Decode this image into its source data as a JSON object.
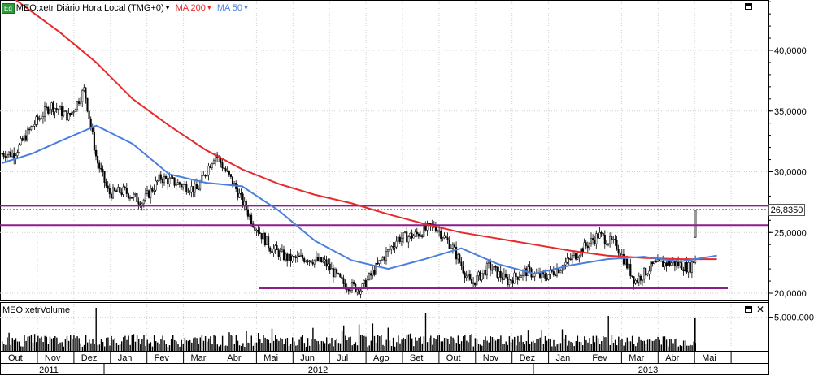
{
  "header": {
    "badge": "Eq",
    "symbol_label": "MEO:xetr Diário Hora Local (TMG+0)",
    "ma200_label": "MA 200",
    "ma50_label": "MA 50",
    "caret": "▼"
  },
  "volume_panel": {
    "title": "MEO:xetrVolume",
    "close_glyph": "✕"
  },
  "last_price": "26,8350",
  "colors": {
    "ma200": "#e8282a",
    "ma50": "#4a7fe0",
    "support_lines": "#8a1e8a",
    "candle": "#000000",
    "badge": "#2e9a3a"
  },
  "chart_data": [
    {
      "type": "line",
      "chart_kind": "candlestick with moving averages",
      "title": "MEO:xetr Diário Hora Local (TMG+0)",
      "y_axis_side": "right",
      "ylim": [
        19500,
        45000
      ],
      "y_ticks": [
        {
          "value": 20000,
          "label": "20,0000"
        },
        {
          "value": 25000,
          "label": "25,0000"
        },
        {
          "value": 30000,
          "label": "30,0000"
        },
        {
          "value": 35000,
          "label": "35,0000"
        },
        {
          "value": 40000,
          "label": "40,0000"
        }
      ],
      "x_months": [
        "Out",
        "Nov",
        "Dez",
        "Jan",
        "Fev",
        "Mar",
        "Abr",
        "Mai",
        "Jun",
        "Jul",
        "Ago",
        "Set",
        "Out",
        "Nov",
        "Dez",
        "Jan",
        "Fev",
        "Mar",
        "Abr",
        "Mai"
      ],
      "x_years": [
        "2011",
        "2012",
        "2013"
      ],
      "series": [
        {
          "name": "MEO:xetr",
          "kind": "candlestick",
          "close_path": [
            [
              "Out 2011",
              31500
            ],
            [
              "Out 2011",
              33800
            ],
            [
              "Nov 2011",
              35500
            ],
            [
              "Nov 2011",
              34500
            ],
            [
              "Dez 2011",
              36800
            ],
            [
              "Dez 2011",
              31000
            ],
            [
              "Dez 2011",
              28200
            ],
            [
              "Jan 2012",
              28400
            ],
            [
              "Jan 2012",
              27500
            ],
            [
              "Fev 2012",
              29500
            ],
            [
              "Fev 2012",
              29000
            ],
            [
              "Mar 2012",
              28500
            ],
            [
              "Mar 2012",
              31500
            ],
            [
              "Abr 2012",
              29000
            ],
            [
              "Abr 2012",
              26000
            ],
            [
              "Mai 2012",
              23800
            ],
            [
              "Mai 2012",
              22800
            ],
            [
              "Jun 2012",
              22900
            ],
            [
              "Jun 2012",
              22500
            ],
            [
              "Jul 2012",
              20800
            ],
            [
              "Jul 2012",
              20300
            ],
            [
              "Ago 2012",
              22500
            ],
            [
              "Ago 2012",
              24500
            ],
            [
              "Set 2012",
              24800
            ],
            [
              "Set 2012",
              25600
            ],
            [
              "Out 2012",
              23800
            ],
            [
              "Out 2012",
              20700
            ],
            [
              "Nov 2012",
              22200
            ],
            [
              "Nov 2012",
              21000
            ],
            [
              "Dez 2012",
              21800
            ],
            [
              "Dez 2012",
              21300
            ],
            [
              "Jan 2013",
              22200
            ],
            [
              "Jan 2013",
              23500
            ],
            [
              "Fev 2013",
              24800
            ],
            [
              "Fev 2013",
              23900
            ],
            [
              "Mar 2013",
              21000
            ],
            [
              "Mar 2013",
              22300
            ],
            [
              "Abr 2013",
              22500
            ],
            [
              "Abr 2013",
              22100
            ],
            [
              "Mai 2013",
              24500
            ],
            [
              "Mai 2013",
              24600
            ],
            [
              "Mai 2013",
              26835
            ]
          ],
          "last": 26835
        },
        {
          "name": "MA 200",
          "path": [
            [
              "Out 2011",
              45000
            ],
            [
              "Nov 2011",
              41500
            ],
            [
              "Dez 2011",
              39000
            ],
            [
              "Jan 2012",
              36000
            ],
            [
              "Fev 2012",
              33800
            ],
            [
              "Mar 2012",
              31800
            ],
            [
              "Abr 2012",
              30200
            ],
            [
              "Mai 2012",
              29000
            ],
            [
              "Jun 2012",
              28100
            ],
            [
              "Jul 2012",
              27400
            ],
            [
              "Ago 2012",
              26500
            ],
            [
              "Set 2012",
              25700
            ],
            [
              "Out 2012",
              25000
            ],
            [
              "Nov 2012",
              24500
            ],
            [
              "Dez 2012",
              24000
            ],
            [
              "Jan 2013",
              23500
            ],
            [
              "Fev 2013",
              23100
            ],
            [
              "Mar 2013",
              22900
            ],
            [
              "Abr 2013",
              22800
            ],
            [
              "Mai 2013",
              22800
            ]
          ]
        },
        {
          "name": "MA 50",
          "path": [
            [
              "Out 2011",
              30700
            ],
            [
              "Out 2011",
              31500
            ],
            [
              "Nov 2011",
              32500
            ],
            [
              "Dez 2011",
              33800
            ],
            [
              "Jan 2012",
              32300
            ],
            [
              "Fev 2012",
              29800
            ],
            [
              "Mar 2012",
              29100
            ],
            [
              "Abr 2012",
              28800
            ],
            [
              "Mai 2012",
              26800
            ],
            [
              "Jun 2012",
              24300
            ],
            [
              "Jul 2012",
              22700
            ],
            [
              "Ago 2012",
              22000
            ],
            [
              "Set 2012",
              22800
            ],
            [
              "Out 2012",
              23700
            ],
            [
              "Nov 2012",
              22400
            ],
            [
              "Dez 2012",
              21600
            ],
            [
              "Jan 2013",
              22300
            ],
            [
              "Fev 2013",
              22800
            ],
            [
              "Mar 2013",
              23000
            ],
            [
              "Abr 2013",
              22600
            ],
            [
              "Mai 2013",
              23100
            ]
          ]
        }
      ],
      "horizontal_lines": [
        {
          "value": 27200,
          "style": "solid"
        },
        {
          "value": 26900,
          "style": "dotted"
        },
        {
          "value": 25600,
          "style": "solid"
        },
        {
          "value": 20400,
          "style": "solid",
          "span": "Jun 2012 – Mai 2013"
        }
      ]
    },
    {
      "type": "bar",
      "title": "MEO:xetrVolume",
      "y_ticks": [
        {
          "value": 5000000,
          "label": "5.000.000"
        }
      ],
      "ylim": [
        0,
        7000000
      ],
      "notable_spikes": [
        [
          "Dez 2011",
          6400000
        ],
        [
          "Set 2012",
          5600000
        ],
        [
          "Fev 2013",
          5200000
        ],
        [
          "Mai 2013",
          4900000
        ]
      ]
    }
  ]
}
